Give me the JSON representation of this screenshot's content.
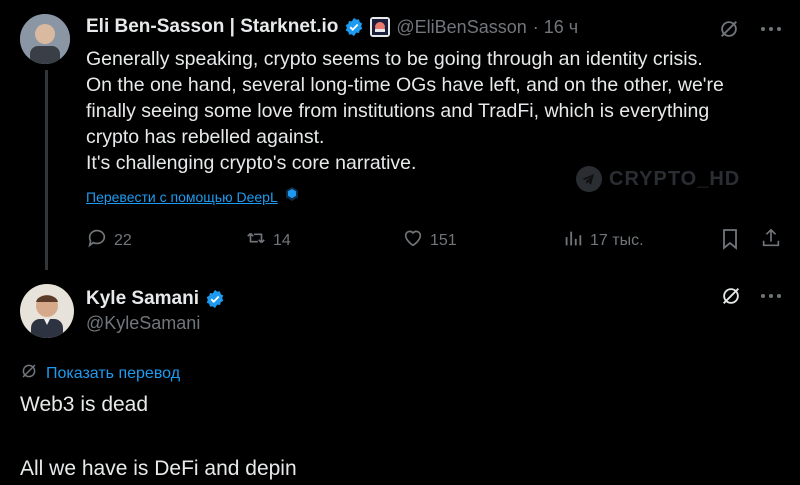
{
  "tweet1": {
    "author_name": "Eli Ben-Sasson | Starknet.io",
    "handle": "@EliBenSasson",
    "time": "· 16 ч",
    "lines": [
      "Generally speaking, crypto seems to be going through an identity crisis.",
      "On the one hand, several long-time OGs have left, and on the other, we're",
      "finally seeing some love from institutions and TradFi, which is everything",
      "crypto has rebelled against.",
      "It's challenging crypto's core narrative."
    ],
    "translate_link": "Перевести с помощью DeepL",
    "actions": {
      "replies": "22",
      "reposts": "14",
      "likes": "151",
      "views": "17 тыс."
    }
  },
  "watermark": "CRYPTO_HD",
  "tweet2": {
    "author_name": "Kyle Samani",
    "handle": "@KyleSamani",
    "show_translation": "Показать перевод",
    "line1": "Web3 is dead",
    "line2": "All we have is DeFi and depin"
  },
  "colors": {
    "background": "#000000",
    "text": "#e7e9ea",
    "muted": "#71767b",
    "accent": "#1d9bf0",
    "verified": "#1d9bf0"
  },
  "icons": [
    "grok-icon",
    "more-icon",
    "verified-icon",
    "reply-icon",
    "repost-icon",
    "like-icon",
    "views-icon",
    "bookmark-icon",
    "share-icon",
    "translate-icon"
  ]
}
